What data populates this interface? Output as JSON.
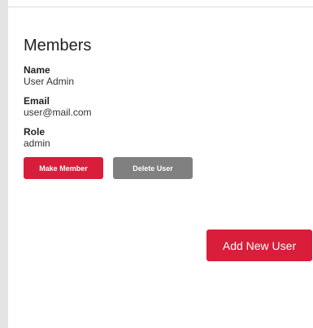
{
  "page": {
    "title": "Members"
  },
  "member": {
    "name_label": "Name",
    "name_value": "User Admin",
    "email_label": "Email",
    "email_value": "user@mail.com",
    "role_label": "Role",
    "role_value": "admin"
  },
  "actions": {
    "make_member_label": "Make Member",
    "delete_user_label": "Delete User",
    "add_new_user_label": "Add New User"
  },
  "colors": {
    "accent": "#d81e3a",
    "muted": "#808080"
  }
}
